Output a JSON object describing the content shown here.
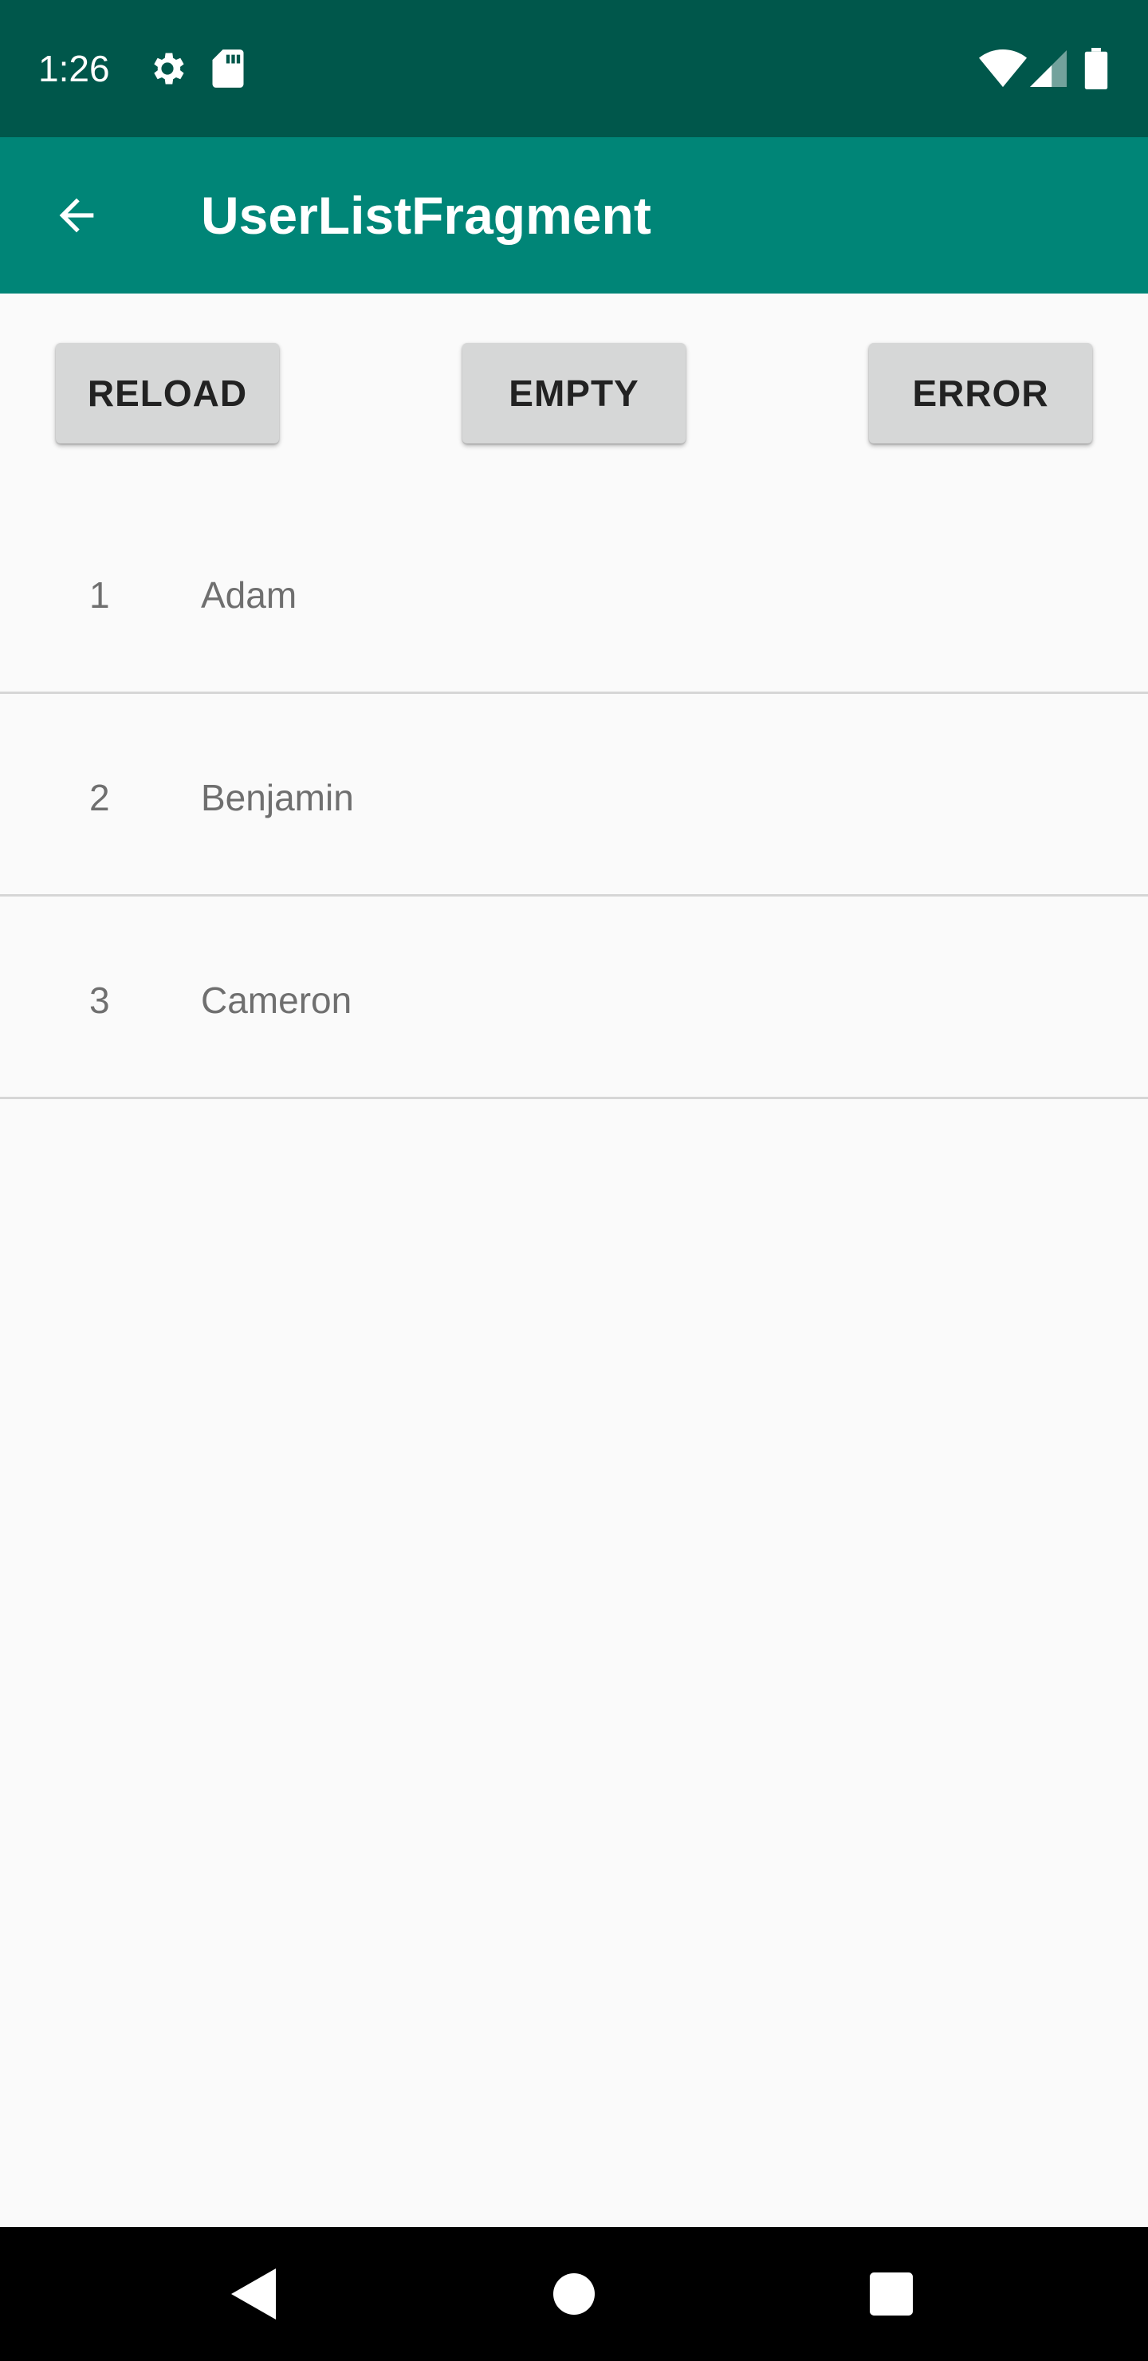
{
  "status_bar": {
    "time": "1:26",
    "icons": [
      "gear-icon",
      "sd-card-icon",
      "wifi-icon",
      "signal-icon",
      "battery-icon"
    ],
    "background": "#00574b"
  },
  "app_bar": {
    "title": "UserListFragment",
    "back_icon": "arrow-back-icon",
    "background": "#008577"
  },
  "actions": {
    "reload_label": "RELOAD",
    "empty_label": "EMPTY",
    "error_label": "ERROR"
  },
  "users": [
    {
      "number": "1",
      "name": "Adam"
    },
    {
      "number": "2",
      "name": "Benjamin"
    },
    {
      "number": "3",
      "name": "Cameron"
    }
  ],
  "nav_bar": {
    "icons": [
      "back-triangle-icon",
      "home-circle-icon",
      "recents-square-icon"
    ]
  }
}
